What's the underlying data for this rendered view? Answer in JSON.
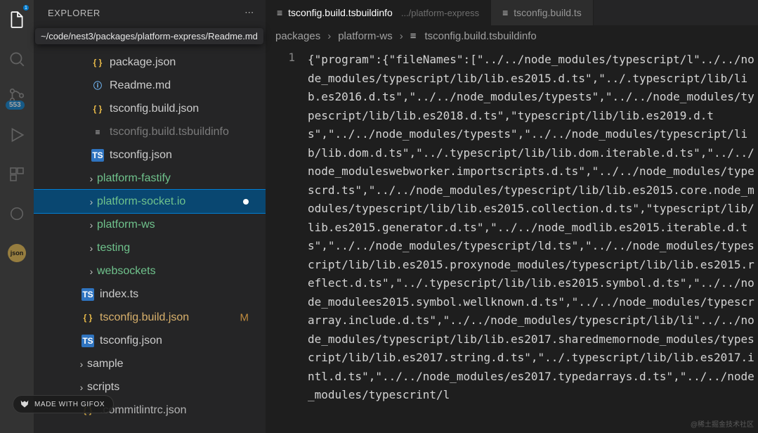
{
  "explorer": {
    "title": "EXPLORER",
    "tooltip_path": "~/code/nest3/packages/platform-express/Readme.md",
    "files": {
      "package_json": "package.json",
      "readme": "Readme.md",
      "tsbuildjson": "tsconfig.build.json",
      "tsbuildinfo": "tsconfig.build.tsbuildinfo",
      "tsconfig": "tsconfig.json",
      "platform_fastify": "platform-fastify",
      "platform_socketio": "platform-socket.io",
      "platform_ws": "platform-ws",
      "testing": "testing",
      "websockets": "websockets",
      "index_ts": "index.ts",
      "tsbuildjson2": "tsconfig.build.json",
      "tsconfig2": "tsconfig.json",
      "sample": "sample",
      "scripts": "scripts",
      "commitlint": ".commitlintrc.json"
    },
    "modified_marker": "M",
    "badge_count": "553"
  },
  "tabs": {
    "tab1_label": "tsconfig.build.tsbuildinfo",
    "tab1_sub": ".../platform-express",
    "tab2_label": "tsconfig.build.ts"
  },
  "breadcrumbs": {
    "seg1": "packages",
    "seg2": "platform-ws",
    "seg3": "tsconfig.build.tsbuildinfo"
  },
  "gutter": {
    "line1": "1"
  },
  "code_text": "{\"program\":{\"fileNames\":[\"../../node_modules/typescript/l\"../../node_modules/typescript/lib/lib.es2015.d.ts\",\"../.typescript/lib/lib.es2016.d.ts\",\"../../node_modules/typests\",\"../../node_modules/typescript/lib/lib.es2018.d.ts\",\"typescript/lib/lib.es2019.d.ts\",\"../../node_modules/typests\",\"../../node_modules/typescript/lib/lib.dom.d.ts\",\"../.typescript/lib/lib.dom.iterable.d.ts\",\"../../node_moduleswebworker.importscripts.d.ts\",\"../../node_modules/typescrd.ts\",\"../../node_modules/typescript/lib/lib.es2015.core.node_modules/typescript/lib/lib.es2015.collection.d.ts\",\"typescript/lib/lib.es2015.generator.d.ts\",\"../../node_modlib.es2015.iterable.d.ts\",\"../../node_modules/typescript/ld.ts\",\"../../node_modules/typescript/lib/lib.es2015.proxynode_modules/typescript/lib/lib.es2015.reflect.d.ts\",\"../.typescript/lib/lib.es2015.symbol.d.ts\",\"../../node_modulees2015.symbol.wellknown.d.ts\",\"../../node_modules/typescrarray.include.d.ts\",\"../../node_modules/typescript/lib/li\"../../node_modules/typescript/lib/lib.es2017.sharedmemornode_modules/typescript/lib/lib.es2017.string.d.ts\",\"../.typescript/lib/lib.es2017.intl.d.ts\",\"../../node_modules/es2017.typedarrays.d.ts\",\"../../node_modules/typescrint/l",
  "gifox_label": "MADE WITH GIFOX",
  "icons": {
    "explorer": "files",
    "sourcecontrol": "branch"
  },
  "corner_watermark": "@稀土掘金技术社区"
}
